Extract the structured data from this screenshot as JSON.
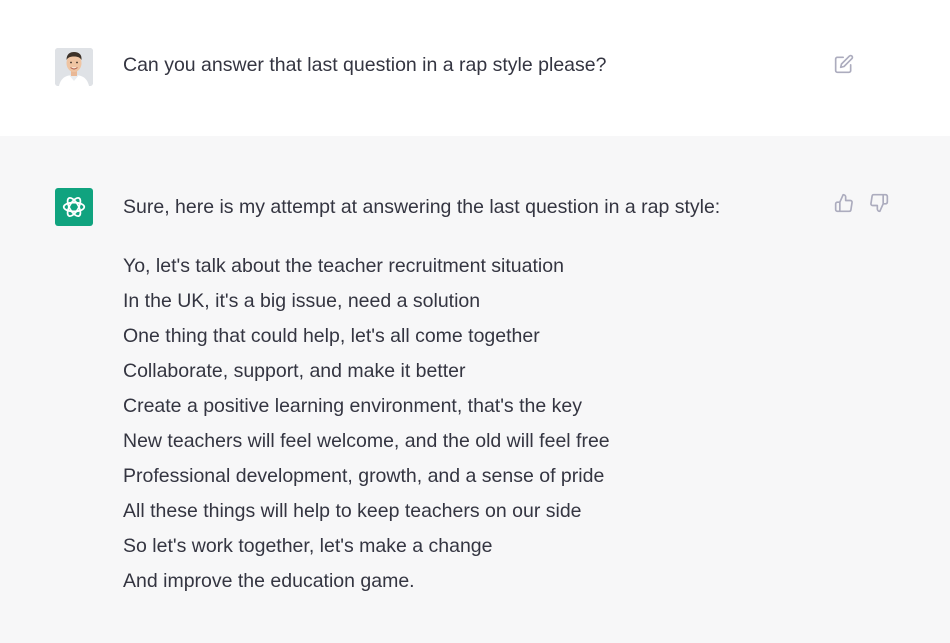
{
  "conversation": {
    "user_message": {
      "avatar": "user-avatar-photo",
      "text": "Can you answer that last question in a rap style please?",
      "edit_icon": "edit-icon"
    },
    "assistant_message": {
      "avatar": "openai-logo-icon",
      "accent_color": "#10a37f",
      "intro": "Sure, here is my attempt at answering the last question in a rap style:",
      "lines": [
        "Yo, let's talk about the teacher recruitment situation",
        "In the UK, it's a big issue, need a solution",
        "One thing that could help, let's all come together",
        "Collaborate, support, and make it better",
        "Create a positive learning environment, that's the key",
        "New teachers will feel welcome, and the old will feel free",
        "Professional development, growth, and a sense of pride",
        "All these things will help to keep teachers on our side",
        "So let's work together, let's make a change",
        "And improve the education game."
      ],
      "feedback_icons": [
        "thumbs-up-icon",
        "thumbs-down-icon"
      ]
    }
  }
}
